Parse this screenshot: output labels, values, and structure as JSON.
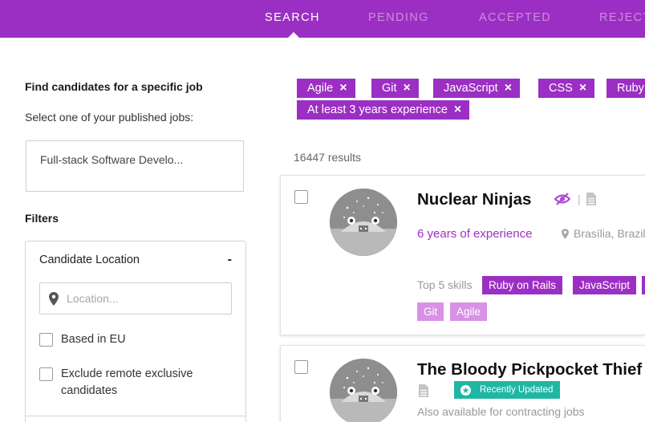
{
  "nav": {
    "tabs": [
      {
        "label": "SEARCH",
        "active": true
      },
      {
        "label": "PENDING",
        "active": false
      },
      {
        "label": "ACCEPTED",
        "active": false
      },
      {
        "label": "REJECTED",
        "active": false
      }
    ],
    "accent_color": "#9b2fc3"
  },
  "sidebar": {
    "find_title": "Find candidates for a specific job",
    "select_prompt": "Select one of your published jobs:",
    "selected_job": "Full-stack Software Develo...",
    "filters_title": "Filters",
    "location_filter": {
      "title": "Candidate Location",
      "toggle": "-",
      "location_placeholder": "Location...",
      "based_in_eu": "Based in EU",
      "exclude_remote": "Exclude remote exclusive candidates"
    }
  },
  "active_filters": [
    {
      "label": "Agile"
    },
    {
      "label": "Git"
    },
    {
      "label": "JavaScript"
    },
    {
      "label": "CSS"
    },
    {
      "label": "Ruby"
    },
    {
      "label": "At least 3 years experience"
    }
  ],
  "remove_icon": "×",
  "results_count": "16447 results",
  "candidates": [
    {
      "name": "Nuclear Ninjas",
      "experience": "6 years of experience",
      "location": "Brasília, Brazil",
      "top_skills_label": "Top 5 skills",
      "primary_skills": [
        "Ruby on Rails",
        "JavaScript"
      ],
      "secondary_skills": [
        "Git",
        "Agile"
      ],
      "icons": [
        "hidden-eye-icon",
        "document-icon"
      ]
    },
    {
      "name": "The Bloody Pickpocket Thief",
      "badge": "Recently Updated",
      "note": "Also available for contracting jobs",
      "icons": [
        "document-icon",
        "star-badge-icon"
      ]
    }
  ],
  "colors": {
    "primary": "#9b2fc3",
    "secondary_skill": "#d891e6",
    "badge": "#1fb7a4"
  }
}
